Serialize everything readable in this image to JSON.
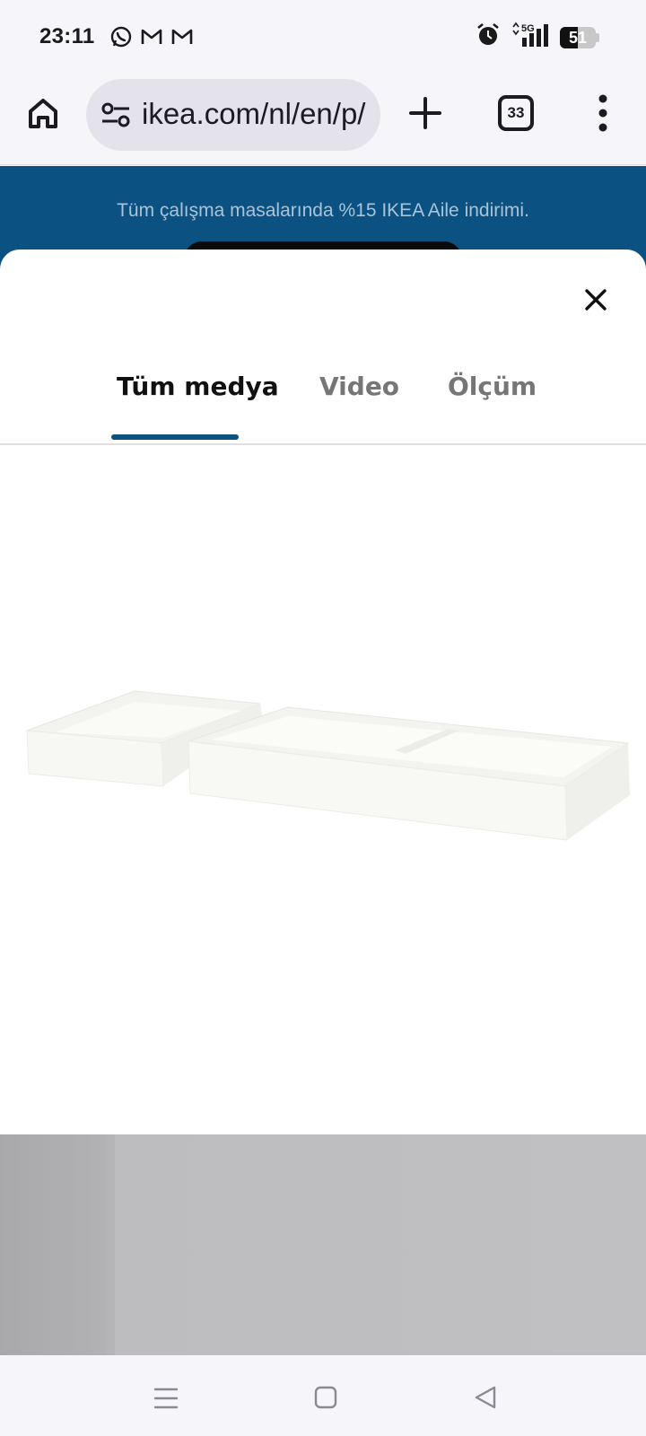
{
  "status_bar": {
    "time": "23:11",
    "notification_icons": [
      "whatsapp-icon",
      "gmail-icon",
      "gmail-icon"
    ],
    "right_icons": [
      "alarm-icon",
      "5g-signal-icon",
      "signal-bars-icon"
    ],
    "battery_level": "51",
    "network_label": "5G"
  },
  "browser": {
    "url": "ikea.com/nl/en/p/s",
    "tab_count": "33",
    "icons": [
      "home-icon",
      "site-settings-icon",
      "plus-icon",
      "tabs-icon",
      "more-vert-icon"
    ]
  },
  "promo": {
    "text": "Tüm çalışma masalarında %15 IKEA Aile indirimi."
  },
  "media_sheet": {
    "close_icon": "close-icon",
    "tabs": [
      {
        "label": "Tüm medya",
        "selected": true
      },
      {
        "label": "Video",
        "selected": false
      },
      {
        "label": "Ölçüm",
        "selected": false
      }
    ],
    "accent_color": "#0b5282"
  },
  "nav_bar": {
    "icons": [
      "recents-icon",
      "home-circle-icon",
      "back-icon"
    ]
  }
}
